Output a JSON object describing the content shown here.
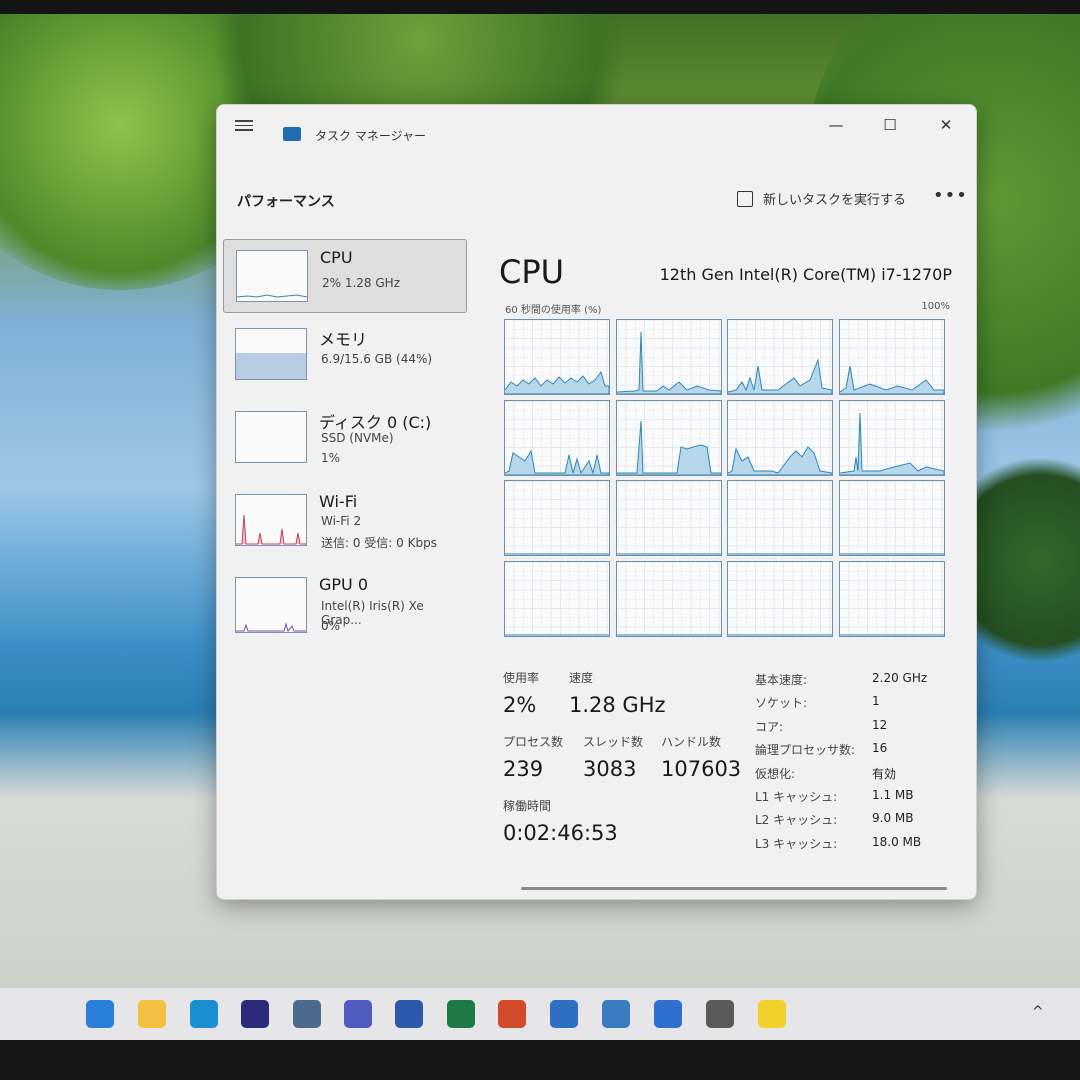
{
  "window": {
    "title": "タスク マネージャー",
    "section": "パフォーマンス",
    "new_task": "新しいタスクを実行する",
    "more": "•••",
    "minimize": "—",
    "maximize": "☐",
    "close": "✕"
  },
  "sidebar": {
    "items": [
      {
        "title": "CPU",
        "line1": "2%  1.28 GHz",
        "line2": ""
      },
      {
        "title": "メモリ",
        "line1": "6.9/15.6 GB (44%)",
        "line2": ""
      },
      {
        "title": "ディスク 0 (C:)",
        "line1": "SSD (NVMe)",
        "line2": "1%"
      },
      {
        "title": "Wi-Fi",
        "line1": "Wi-Fi 2",
        "line2": "送信: 0  受信: 0 Kbps"
      },
      {
        "title": "GPU 0",
        "line1": "Intel(R) Iris(R) Xe Grap...",
        "line2": "0%"
      }
    ]
  },
  "cpu": {
    "heading": "CPU",
    "model": "12th Gen Intel(R) Core(TM) i7-1270P",
    "util_label": "60 秒間の使用率 (%)",
    "util_max": "100%"
  },
  "stats": {
    "usage_label": "使用率",
    "usage_value": "2%",
    "speed_label": "速度",
    "speed_value": "1.28 GHz",
    "processes_label": "プロセス数",
    "processes_value": "239",
    "threads_label": "スレッド数",
    "threads_value": "3083",
    "handles_label": "ハンドル数",
    "handles_value": "107603",
    "uptime_label": "稼働時間",
    "uptime_value": "0:02:46:53"
  },
  "specs": [
    {
      "key": "基本速度:",
      "value": "2.20 GHz"
    },
    {
      "key": "ソケット:",
      "value": "1"
    },
    {
      "key": "コア:",
      "value": "12"
    },
    {
      "key": "論理プロセッサ数:",
      "value": "16"
    },
    {
      "key": "仮想化:",
      "value": "有効"
    },
    {
      "key": "L1 キャッシュ:",
      "value": "1.1 MB"
    },
    {
      "key": "L2 キャッシュ:",
      "value": "9.0 MB"
    },
    {
      "key": "L3 キャッシュ:",
      "value": "18.0 MB"
    }
  ],
  "taskbar": {
    "icons": [
      "windows-start-icon",
      "file-explorer-icon",
      "edge-icon",
      "store-icon",
      "remote-desktop-icon",
      "teams-icon",
      "word-icon",
      "excel-icon",
      "powerpoint-icon",
      "snip-icon",
      "task-manager-icon",
      "security-icon",
      "settings-icon",
      "app-x-icon"
    ],
    "tray_chevron": "^"
  },
  "colors": {
    "graph_line": "#2f86b8",
    "graph_fill": "#b9d7ea",
    "wifi_graph": "#c2415b",
    "gpu_graph": "#7a52a8"
  }
}
